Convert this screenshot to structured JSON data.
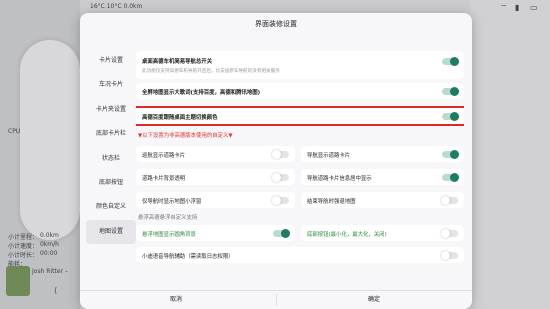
{
  "background": {
    "top_temps": "16°C  10°C  0.0km",
    "left_labels": [
      "CPU",
      "小计里程：",
      "小计速度：",
      "小计时长：",
      "能耗：",
      "Josh Ritter –"
    ],
    "left_values": [
      "",
      "0.0km",
      "0km/h",
      "00:00",
      "",
      ""
    ]
  },
  "dialog": {
    "title": "界面装修设置",
    "sidebar": [
      "卡片设置",
      "车况卡片",
      "卡片夹设置",
      "底部卡片栏",
      "状态栏",
      "底部按钮",
      "颜色自定义",
      "地图设置"
    ],
    "active_index": 7,
    "rows": {
      "r1_label": "桌面高德车机简易导航总开关",
      "r1_sub": "此功能仅支持高德车机导航开启后，比安迪原车导航的没有相关服务",
      "r2_label": "全屏地图显示大歌词(支持百度，高德和腾讯地图)",
      "r3_label": "高德百度跟随桌面主题切换颜色",
      "note": "▼以下设置为非高德版本使用的自定义▼",
      "g1": "巡航显示道路卡片",
      "g2": "导航显示道路卡片",
      "g3": "道路卡片背景透明",
      "g4": "导航道路卡片信息居中显示",
      "g5": "仅导航时显示地图小浮窗",
      "g6": "结束导航时强退地图",
      "section": "悬浮高德悬浮自定义支持",
      "g7": "悬浮地图显示圆角背景",
      "g8": "底部按钮(最小化，最大化，关闭)",
      "r9": "小迪语音导航辅助（需读取日志权限）"
    },
    "toggles": {
      "r1": true,
      "r2": true,
      "r3": true,
      "g1": false,
      "g2": true,
      "g3": false,
      "g4": true,
      "g5": false,
      "g6": false,
      "g7": true,
      "g8": false,
      "r9": false
    },
    "footer": {
      "cancel": "取消",
      "confirm": "确定"
    }
  },
  "colors": {
    "accent": "#1e7c64",
    "highlight": "#e02828",
    "note": "#e03030"
  },
  "icons": [
    "wifi-icon",
    "signal-icon",
    "battery-icon",
    "back-icon"
  ]
}
